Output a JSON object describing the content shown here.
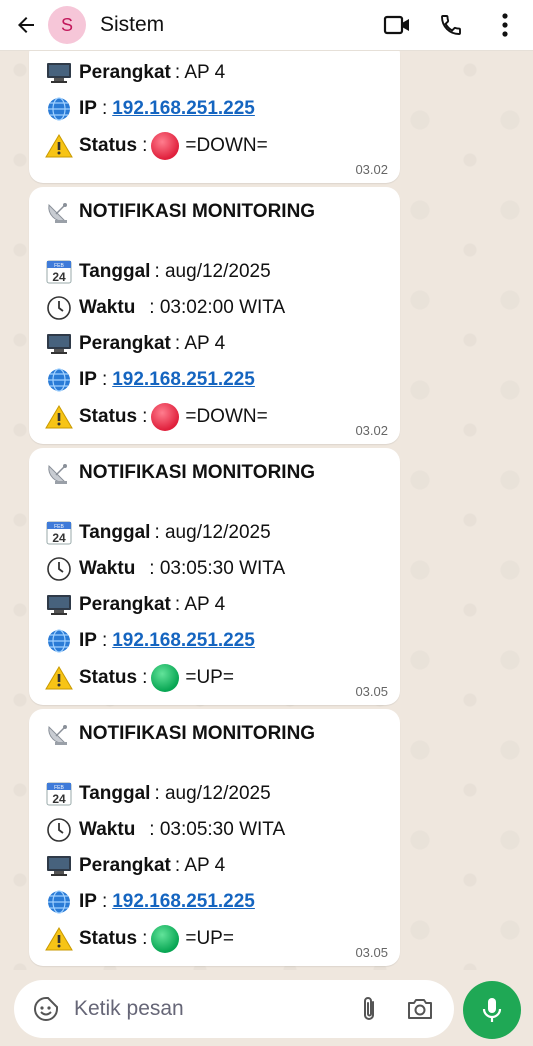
{
  "header": {
    "title": "Sistem",
    "avatar_letter": "S",
    "back_icon": "arrow-left-icon",
    "video_icon": "video-call-icon",
    "call_icon": "phone-icon",
    "menu_icon": "more-vert-icon"
  },
  "colors": {
    "down": "#e0203c",
    "up": "#08a653",
    "link": "#1565c0",
    "send": "#1fa855"
  },
  "messages": [
    {
      "device_label": "Perangkat",
      "device_value": ": AP 4",
      "ip_label": "IP",
      "ip_sep": ":",
      "ip_value": "192.168.251.225",
      "status_label": "Status",
      "status_sep": ":",
      "status_text": "=DOWN=",
      "status": "down",
      "time": "03.02"
    },
    {
      "heading": "NOTIFIKASI MONITORING",
      "date_label": "Tanggal",
      "date_value": ": aug/12/2025",
      "time_label": "Waktu",
      "time_value": ": 03:02:00 WITA",
      "device_label": "Perangkat",
      "device_value": ": AP 4",
      "ip_label": "IP",
      "ip_sep": ":",
      "ip_value": "192.168.251.225",
      "status_label": "Status",
      "status_sep": ":",
      "status_text": "=DOWN=",
      "status": "down",
      "time": "03.02"
    },
    {
      "heading": "NOTIFIKASI MONITORING",
      "date_label": "Tanggal",
      "date_value": ": aug/12/2025",
      "time_label": "Waktu",
      "time_value": ": 03:05:30 WITA",
      "device_label": "Perangkat",
      "device_value": ": AP 4",
      "ip_label": "IP",
      "ip_sep": ":",
      "ip_value": "192.168.251.225",
      "status_label": "Status",
      "status_sep": ":",
      "status_text": "=UP=",
      "status": "up",
      "time": "03.05"
    },
    {
      "heading": "NOTIFIKASI MONITORING",
      "date_label": "Tanggal",
      "date_value": ": aug/12/2025",
      "time_label": "Waktu",
      "time_value": ": 03:05:30 WITA",
      "device_label": "Perangkat",
      "device_value": ": AP 4",
      "ip_label": "IP",
      "ip_sep": ":",
      "ip_value": "192.168.251.225",
      "status_label": "Status",
      "status_sep": ":",
      "status_text": "=UP=",
      "status": "up",
      "time": "03.05"
    }
  ],
  "composer": {
    "placeholder": "Ketik pesan",
    "emoji_icon": "sticker-icon",
    "attach_icon": "paperclip-icon",
    "camera_icon": "camera-icon",
    "mic_icon": "mic-icon"
  },
  "calendar_icon_text": {
    "month": "FEB",
    "day": "24"
  }
}
